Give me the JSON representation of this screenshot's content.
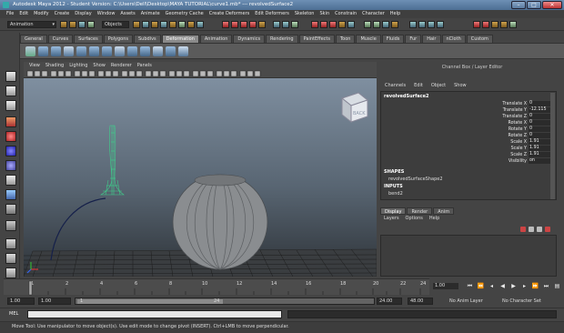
{
  "window": {
    "title": "Autodesk Maya 2012 - Student Version: C:\\Users\\Dell\\Desktop\\MAYA TUTORIAL\\curve1.mb*   ---   revolvedSurface2",
    "minimize": "–",
    "maximize": "□",
    "close": "✕"
  },
  "menubar": [
    "File",
    "Edit",
    "Modify",
    "Create",
    "Display",
    "Window",
    "Assets",
    "Animate",
    "Geometry Cache",
    "Create Deformers",
    "Edit Deformers",
    "Skeleton",
    "Skin",
    "Constrain",
    "Character",
    "Help"
  ],
  "statusline": {
    "mode": "Animation",
    "objects": "Objects"
  },
  "shelf": {
    "tabs": [
      "General",
      "Curves",
      "Surfaces",
      "Polygons",
      "Subdivs",
      "Deformation",
      "Animation",
      "Dynamics",
      "Rendering",
      "PaintEffects",
      "Toon",
      "Muscle",
      "Fluids",
      "Fur",
      "Hair",
      "nCloth",
      "Custom"
    ],
    "active_tab": "Deformation"
  },
  "viewport": {
    "menus": [
      "View",
      "Shading",
      "Lighting",
      "Show",
      "Renderer",
      "Panels"
    ],
    "viewcube_label": "BACK"
  },
  "channel_box": {
    "header": "Channel Box / Layer Editor",
    "menus": [
      "Channels",
      "Edit",
      "Object",
      "Show"
    ],
    "object_name": "revolvedSurface2",
    "attributes": [
      {
        "label": "Translate X",
        "value": "0"
      },
      {
        "label": "Translate Y",
        "value": "-12.115"
      },
      {
        "label": "Translate Z",
        "value": "0"
      },
      {
        "label": "Rotate X",
        "value": "0"
      },
      {
        "label": "Rotate Y",
        "value": "0"
      },
      {
        "label": "Rotate Z",
        "value": "0"
      },
      {
        "label": "Scale X",
        "value": "1.91"
      },
      {
        "label": "Scale Y",
        "value": "1.91"
      },
      {
        "label": "Scale Z",
        "value": "1.91"
      },
      {
        "label": "Visibility",
        "value": "on"
      }
    ],
    "shapes_title": "SHAPES",
    "shape_item": "revolvedSurfaceShape2",
    "inputs_title": "INPUTS",
    "input_item": "bend2"
  },
  "layer_editor": {
    "tabs": [
      "Display",
      "Render",
      "Anim"
    ],
    "active_tab": "Display",
    "menus": [
      "Layers",
      "Options",
      "Help"
    ]
  },
  "timeline": {
    "ticks": [
      "1",
      "2",
      "4",
      "6",
      "8",
      "10",
      "12",
      "14",
      "16",
      "18",
      "20",
      "22",
      "24"
    ],
    "current_frame": "1.00"
  },
  "range": {
    "start": "1.00",
    "inner_start": "1.00",
    "bar_start": "1",
    "bar_end": "24",
    "end": "24.00",
    "outer_end": "48.00",
    "anim_layer": "No Anim Layer",
    "character_set": "No Character Set"
  },
  "command": {
    "label": "MEL"
  },
  "helpline": "Move Tool: Use manipulator to move object(s). Use edit mode to change pivot (INSERT). Ctrl+LMB to move perpendicular.",
  "colors": {
    "selection_green": "#3fd08c",
    "viewport_top": "#7f8fa0",
    "viewport_bottom": "#2e3338"
  }
}
